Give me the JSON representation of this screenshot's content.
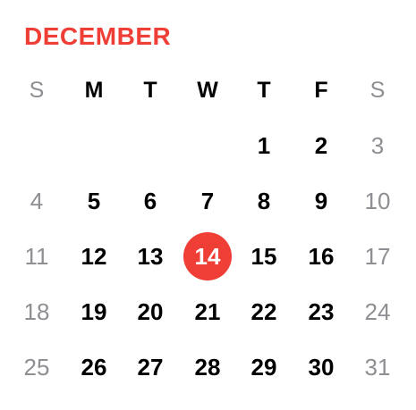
{
  "accent_color": "#ef3e36",
  "month": {
    "title": "DECEMBER"
  },
  "weekdays": [
    "S",
    "M",
    "T",
    "W",
    "T",
    "F",
    "S"
  ],
  "weeks": [
    [
      "",
      "",
      "",
      "",
      "1",
      "2",
      "3"
    ],
    [
      "4",
      "5",
      "6",
      "7",
      "8",
      "9",
      "10"
    ],
    [
      "11",
      "12",
      "13",
      "14",
      "15",
      "16",
      "17"
    ],
    [
      "18",
      "19",
      "20",
      "21",
      "22",
      "23",
      "24"
    ],
    [
      "25",
      "26",
      "27",
      "28",
      "29",
      "30",
      "31"
    ]
  ],
  "today": "14"
}
